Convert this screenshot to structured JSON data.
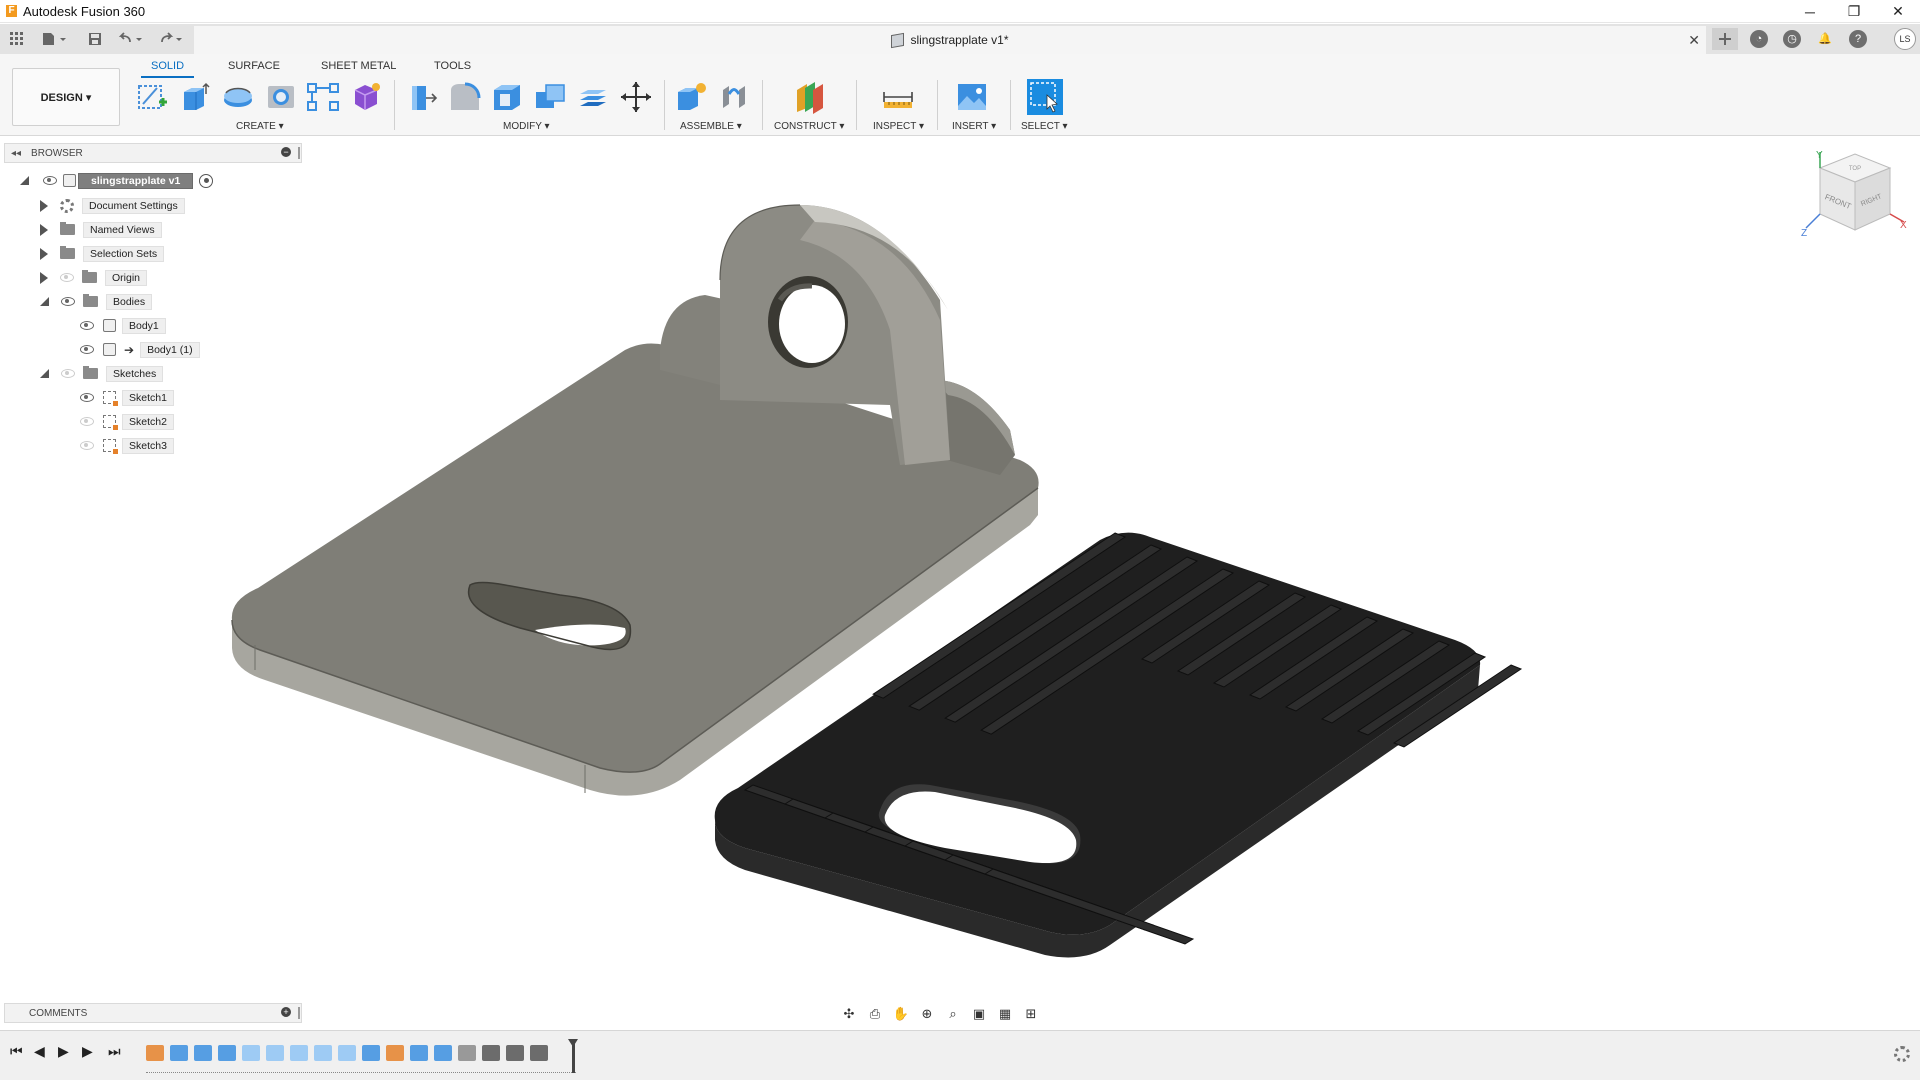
{
  "window": {
    "app_title": "Autodesk Fusion 360",
    "logo_letter": "F",
    "minimize": "─",
    "restore": "❐",
    "close": "✕"
  },
  "document": {
    "tab_title": "slingstrapplate v1*",
    "close": "✕"
  },
  "user": {
    "initials": "LS"
  },
  "ribbon": {
    "tabs": [
      "SOLID",
      "SURFACE",
      "SHEET METAL",
      "TOOLS"
    ],
    "workspace_label": "DESIGN ▾",
    "groups": {
      "create": "CREATE ▾",
      "modify": "MODIFY ▾",
      "assemble": "ASSEMBLE ▾",
      "construct": "CONSTRUCT ▾",
      "inspect": "INSPECT ▾",
      "insert": "INSERT ▾",
      "select": "SELECT ▾"
    }
  },
  "browser": {
    "header": "BROWSER",
    "root": "slingstrapplate v1",
    "items": {
      "document_settings": "Document Settings",
      "named_views": "Named Views",
      "selection_sets": "Selection Sets",
      "origin": "Origin",
      "bodies": "Bodies",
      "body1": "Body1",
      "body1_copy": "Body1 (1)",
      "sketches": "Sketches",
      "sketch1": "Sketch1",
      "sketch2": "Sketch2",
      "sketch3": "Sketch3"
    }
  },
  "comments": {
    "header": "COMMENTS"
  },
  "viewcube": {
    "front": "FRONT",
    "right": "RIGHT",
    "top": "TOP",
    "axis_x": "X",
    "axis_y": "Y",
    "axis_z": "Z"
  },
  "colors": {
    "accent": "#0a6fc2",
    "plate_top": "#807f78",
    "plate_side": "#a5a49d",
    "pad_top": "#1e1e1e",
    "pad_side": "#2b2b2b"
  }
}
